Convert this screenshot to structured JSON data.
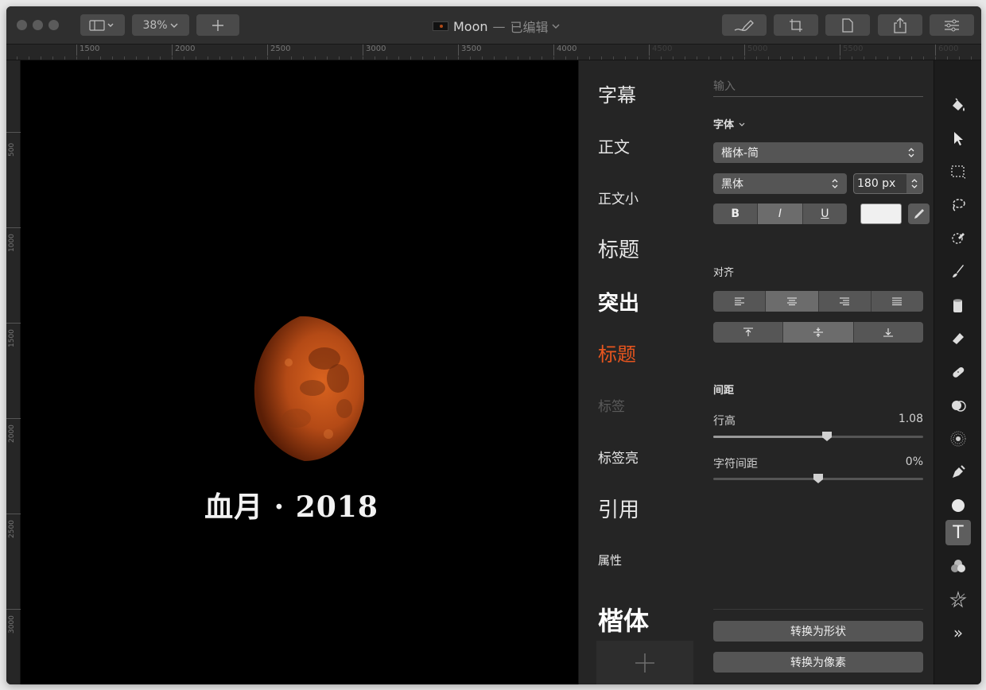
{
  "titlebar": {
    "zoom": "38%",
    "doc_name": "Moon",
    "separator": "—",
    "edited": "已编辑"
  },
  "ruler": {
    "top_ticks": [
      "1500",
      "2000",
      "2500",
      "3000",
      "3500",
      "4000",
      "4500",
      "5000",
      "5500",
      "6000"
    ],
    "left_ticks": [
      "500",
      "1000",
      "1500",
      "2000",
      "2500",
      "3000"
    ]
  },
  "canvas": {
    "caption": "血月 · 2018"
  },
  "styles": {
    "items": [
      "字幕",
      "正文",
      "正文小",
      "标题",
      "突出",
      "标题",
      "标签",
      "标签亮",
      "引用",
      "属性",
      "楷体"
    ],
    "add_label": "+"
  },
  "inspector": {
    "text_placeholder": "输入",
    "font_label": "字体",
    "font_family": "楷体-简",
    "font_style": "黑体",
    "font_size": "180 px",
    "bold": "B",
    "italic": "I",
    "underline": "U",
    "text_color": "#f0f0f0",
    "align_label": "对齐",
    "spacing_label": "间距",
    "line_height_label": "行高",
    "line_height_value": "1.08",
    "line_height_fraction": 0.54,
    "letter_spacing_label": "字符间距",
    "letter_spacing_value": "0%",
    "letter_spacing_fraction": 0.5,
    "convert_shape": "转换为形状",
    "convert_pixels": "转换为像素"
  },
  "tools": {
    "more": "»",
    "text_tool": "T"
  },
  "colors": {
    "accent_style": "#e8551e",
    "moon": "#b04a18"
  }
}
